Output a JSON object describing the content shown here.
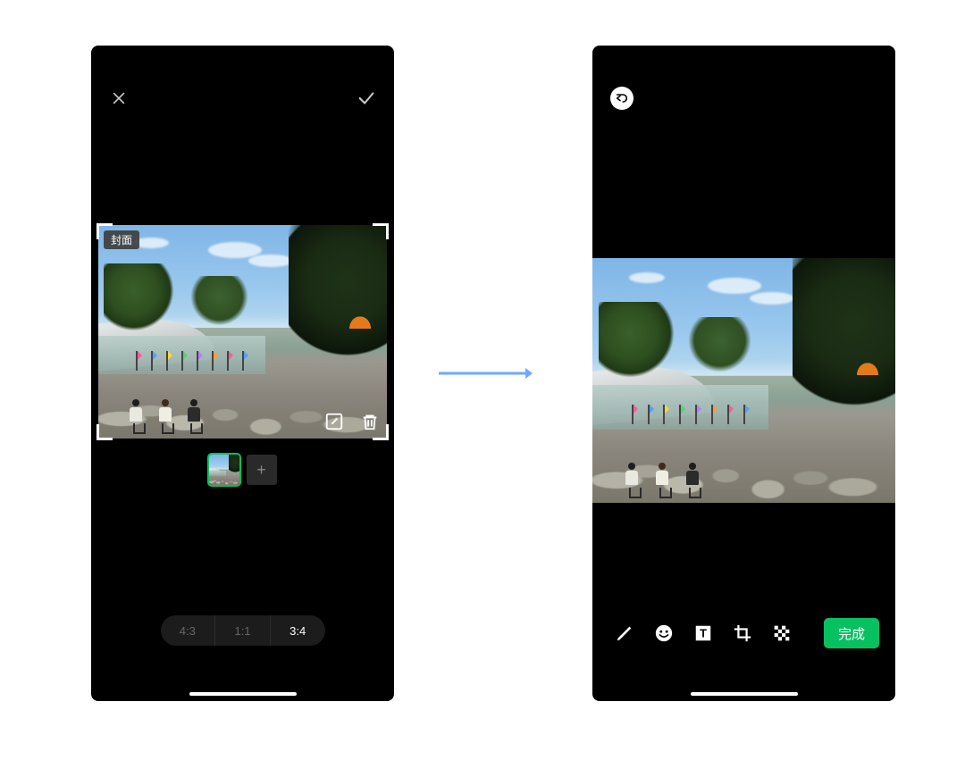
{
  "left": {
    "cover_tag": "封面",
    "aspect_ratios": [
      "4:3",
      "1:1",
      "3:4"
    ],
    "aspect_active_index": 2,
    "add_label": "+"
  },
  "right": {
    "done_label": "完成"
  },
  "colors": {
    "accent_green": "#07c160",
    "arrow_blue": "#6fa8ff"
  }
}
